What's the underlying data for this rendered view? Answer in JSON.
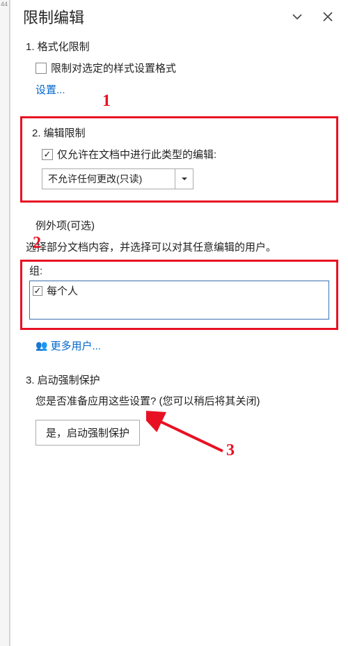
{
  "ruler": {
    "tick": "44"
  },
  "pane": {
    "title": "限制编辑"
  },
  "section1": {
    "title": "1. 格式化限制",
    "checkbox_label": "限制对选定的样式设置格式",
    "settings_link": "设置..."
  },
  "section2": {
    "title": "2. 编辑限制",
    "checkbox_label": "仅允许在文档中进行此类型的编辑:",
    "dropdown_value": "不允许任何更改(只读)",
    "exceptions_title": "例外项(可选)",
    "exceptions_desc": "选择部分文档内容，并选择可以对其任意编辑的用户。",
    "group_label": "组:",
    "group_item": "每个人",
    "more_users": "更多用户..."
  },
  "section3": {
    "title": "3. 启动强制保护",
    "desc": "您是否准备应用这些设置? (您可以稍后将其关闭)",
    "button": "是，启动强制保护"
  },
  "annotations": {
    "n1": "1",
    "n2": "2",
    "n3": "3"
  }
}
